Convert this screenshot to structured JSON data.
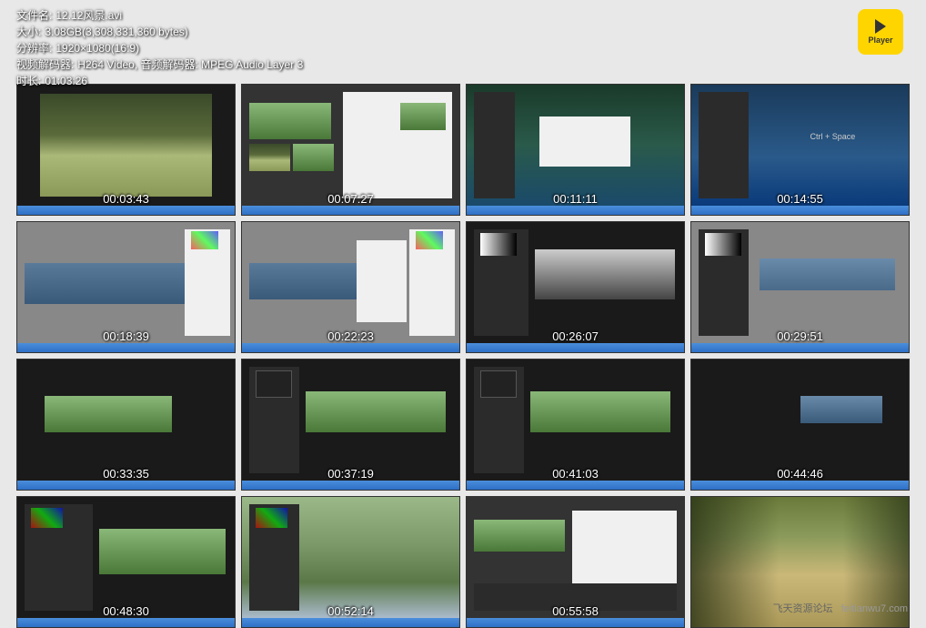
{
  "info": {
    "filename_label": "文件名:",
    "filename_value": "12.12风景.avi",
    "size_label": "大小:",
    "size_value": "3.08GB(3,308,331,360 bytes)",
    "resolution_label": "分辨率:",
    "resolution_value": "1920×1080(16:9)",
    "codec_label": "视频解码器:",
    "codec_value": "H264 Video, 音频解码器: MPEG Audio Layer 3",
    "duration_label": "时长:",
    "duration_value": "01:03:26"
  },
  "player": {
    "label": "Player"
  },
  "thumbnails": [
    {
      "timestamp": "00:03:43",
      "style": "forest-viewer"
    },
    {
      "timestamp": "00:07:27",
      "style": "bridge-panel"
    },
    {
      "timestamp": "00:11:11",
      "style": "blue-dialog"
    },
    {
      "timestamp": "00:14:55",
      "style": "blue-ctrl",
      "hint": "Ctrl + Space"
    },
    {
      "timestamp": "00:18:39",
      "style": "gray-pano"
    },
    {
      "timestamp": "00:22:23",
      "style": "gray-pano-panel"
    },
    {
      "timestamp": "00:26:07",
      "style": "dark-bw"
    },
    {
      "timestamp": "00:29:51",
      "style": "gray-small"
    },
    {
      "timestamp": "00:33:35",
      "style": "dark-pano"
    },
    {
      "timestamp": "00:37:19",
      "style": "dark-curves"
    },
    {
      "timestamp": "00:41:03",
      "style": "dark-curves2"
    },
    {
      "timestamp": "00:44:46",
      "style": "dark-tiny"
    },
    {
      "timestamp": "00:48:30",
      "style": "dark-green"
    },
    {
      "timestamp": "00:52:14",
      "style": "green-river"
    },
    {
      "timestamp": "00:55:58",
      "style": "green-dialog"
    },
    {
      "timestamp": "",
      "style": "forest-final"
    }
  ],
  "watermark": {
    "title": "飞天资源论坛",
    "url": "feitianwu7.com"
  }
}
